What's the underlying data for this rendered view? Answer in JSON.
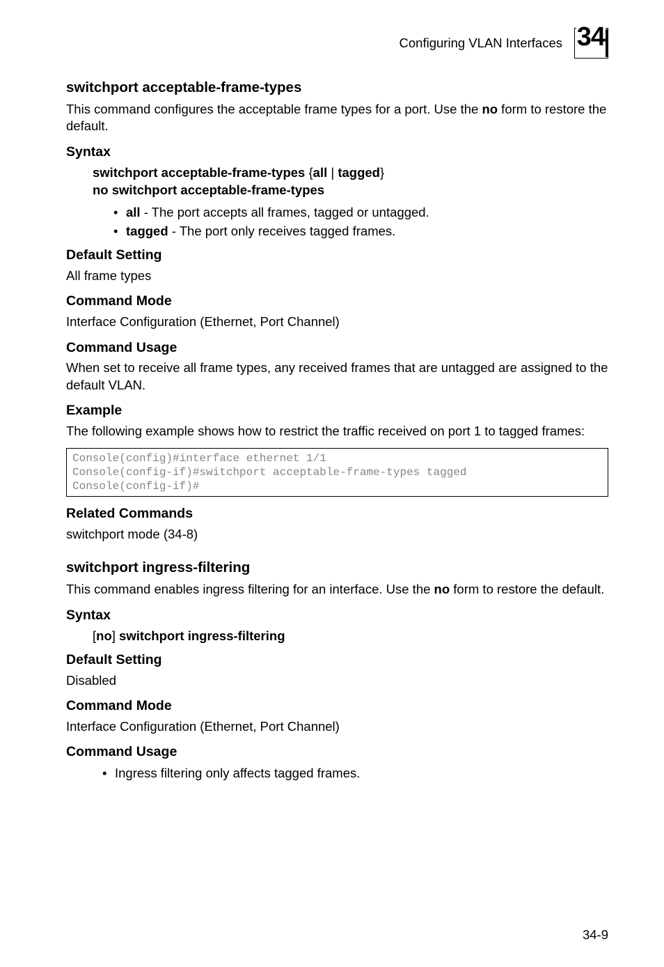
{
  "header": {
    "running_head": "Configuring VLAN Interfaces",
    "chapter_number": "34"
  },
  "section1": {
    "title": "switchport acceptable-frame-types",
    "intro_pre": "This command configures the acceptable frame types for a port. Use the ",
    "intro_bold": "no",
    "intro_post": " form to restore the default.",
    "syntax_heading": "Syntax",
    "syntax_line1_a": "switchport acceptable-frame-types",
    "syntax_line1_brace_open": " {",
    "syntax_line1_b": "all",
    "syntax_line1_pipe": " | ",
    "syntax_line1_c": "tagged",
    "syntax_line1_brace_close": "}",
    "syntax_line2": "no switchport acceptable-frame-types",
    "bullet1_b": "all",
    "bullet1_rest": " - The port accepts all frames, tagged or untagged.",
    "bullet2_b": "tagged",
    "bullet2_rest": " - The port only receives tagged frames.",
    "default_heading": "Default Setting",
    "default_value": "All frame types",
    "mode_heading": "Command Mode",
    "mode_value": "Interface Configuration (Ethernet, Port Channel)",
    "usage_heading": "Command Usage",
    "usage_value": "When set to receive all frame types, any received frames that are untagged are assigned to the default VLAN.",
    "example_heading": "Example",
    "example_intro": "The following example shows how to restrict the traffic received on port 1 to tagged frames:",
    "example_code": "Console(config)#interface ethernet 1/1\nConsole(config-if)#switchport acceptable-frame-types tagged\nConsole(config-if)#",
    "related_heading": "Related Commands",
    "related_value": "switchport mode (34-8)"
  },
  "section2": {
    "title": "switchport ingress-filtering",
    "intro_pre": "This command enables ingress filtering for an interface. Use the ",
    "intro_bold": "no",
    "intro_post": " form to restore the default.",
    "syntax_heading": "Syntax",
    "syntax_bracket_open": "[",
    "syntax_no": "no",
    "syntax_bracket_close": "] ",
    "syntax_cmd": "switchport ingress-filtering",
    "default_heading": "Default Setting",
    "default_value": "Disabled",
    "mode_heading": "Command Mode",
    "mode_value": "Interface Configuration (Ethernet, Port Channel)",
    "usage_heading": "Command Usage",
    "usage_bullet1": "Ingress filtering only affects tagged frames."
  },
  "page_number": "34-9"
}
